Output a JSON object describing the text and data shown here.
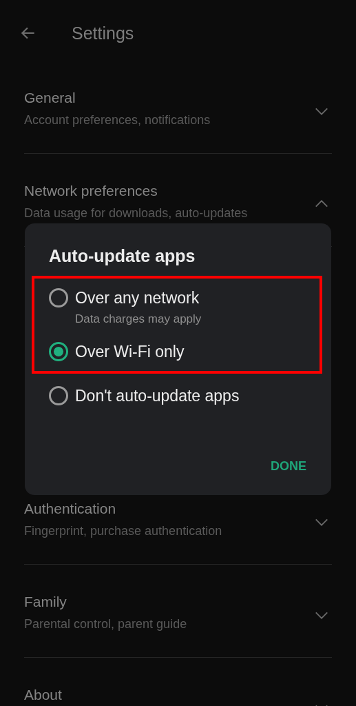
{
  "header": {
    "title": "Settings"
  },
  "sections": [
    {
      "title": "General",
      "subtitle": "Account preferences, notifications",
      "expanded": false
    },
    {
      "title": "Network preferences",
      "subtitle": "Data usage for downloads, auto-updates",
      "expanded": true
    },
    {
      "title": "Authentication",
      "subtitle": "Fingerprint, purchase authentication",
      "expanded": false
    },
    {
      "title": "Family",
      "subtitle": "Parental control, parent guide",
      "expanded": false
    },
    {
      "title": "About",
      "expanded": false
    }
  ],
  "dialog": {
    "title": "Auto-update apps",
    "options": [
      {
        "label": "Over any network",
        "subtitle": "Data charges may apply",
        "selected": false,
        "highlighted": true
      },
      {
        "label": "Over Wi-Fi only",
        "selected": true,
        "highlighted": true
      },
      {
        "label": "Don't auto-update apps",
        "selected": false,
        "highlighted": false
      }
    ],
    "button": "DONE"
  }
}
